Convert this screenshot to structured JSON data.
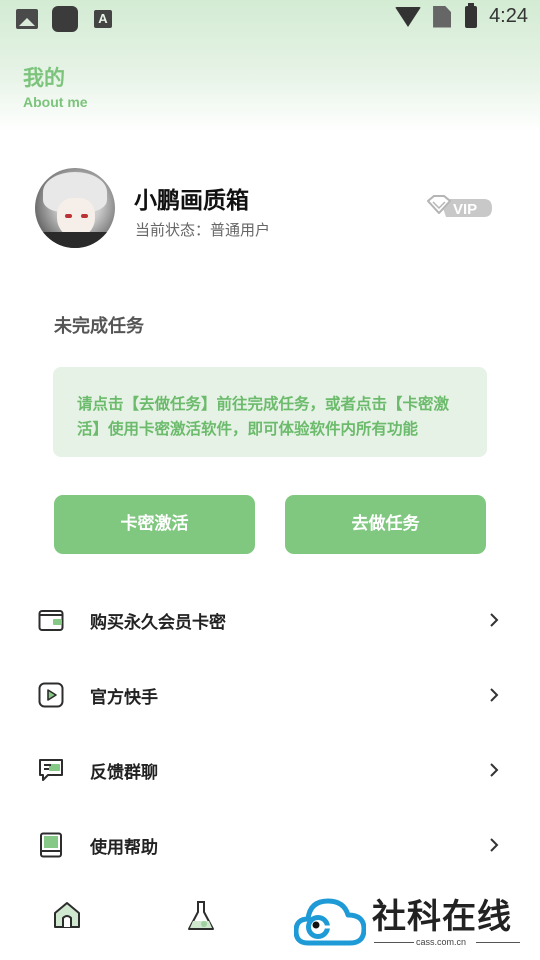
{
  "status_bar": {
    "time": "4:24",
    "icons": [
      "photo-icon",
      "app-icon",
      "font-icon",
      "wifi-icon",
      "no-sim-icon",
      "battery-charging-icon"
    ]
  },
  "header": {
    "title": "我的",
    "subtitle": "About me"
  },
  "profile": {
    "name": "小鹏画质箱",
    "status": "当前状态：普通用户",
    "badge": "VIP"
  },
  "tasks": {
    "title": "未完成任务",
    "notice": "请点击【去做任务】前往完成任务，或者点击【卡密激活】使用卡密激活软件，即可体验软件内所有功能"
  },
  "actions": {
    "activate_label": "卡密激活",
    "do_task_label": "去做任务"
  },
  "menu": {
    "items": [
      {
        "label": "购买永久会员卡密",
        "icon": "wallet-icon"
      },
      {
        "label": "官方快手",
        "icon": "video-play-icon"
      },
      {
        "label": "反馈群聊",
        "icon": "chat-icon"
      },
      {
        "label": "使用帮助",
        "icon": "book-icon"
      }
    ]
  },
  "tabbar": {
    "tabs": [
      {
        "icon": "home-icon"
      },
      {
        "icon": "flask-icon"
      }
    ]
  },
  "watermark": {
    "text": "社科在线",
    "domain": "cass.com.cn"
  },
  "colors": {
    "accent": "#80c780",
    "accent_text": "#6cbb6c",
    "notice_bg": "#e6f2e6",
    "header_gradient_top": "#d3ebd3",
    "watermark_blue": "#1e9bd7"
  }
}
